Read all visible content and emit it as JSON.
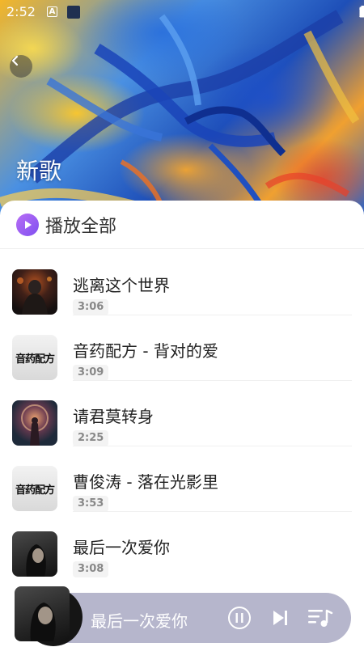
{
  "status_bar": {
    "time": "2:52",
    "icon_a": "A"
  },
  "header": {
    "title": "新歌",
    "back_icon": "chevron-left-icon"
  },
  "play_all": {
    "label": "播放全部",
    "icon": "play-circle-icon",
    "color": "#8a5cf5"
  },
  "songs": [
    {
      "title": "逃离这个世界",
      "duration": "3:06"
    },
    {
      "title": "音药配方 - 背对的爱",
      "duration": "3:09",
      "cover_text": "音药配方"
    },
    {
      "title": "请君莫转身",
      "duration": "2:25"
    },
    {
      "title": "曹俊涛 - 落在光影里",
      "duration": "3:53",
      "cover_text": "音药配方"
    },
    {
      "title": "最后一次爱你",
      "duration": "3:08"
    }
  ],
  "player": {
    "title": "最后一次爱你",
    "pause_icon": "pause-circle-icon",
    "next_icon": "skip-next-icon",
    "playlist_icon": "playlist-music-icon",
    "background": "#b6b6cc"
  }
}
